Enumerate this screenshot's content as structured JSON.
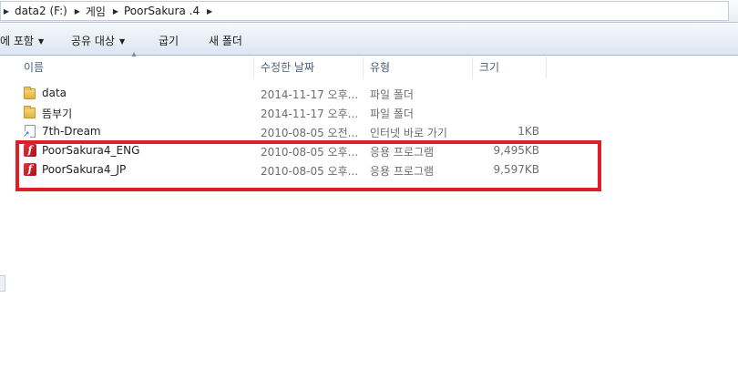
{
  "address_bar": {
    "crumbs": [
      "data2 (F:)",
      "게임",
      "PoorSakura .4"
    ]
  },
  "command_bar": {
    "include_label": "에 포함",
    "share_label": "공유 대상",
    "burn_label": "굽기",
    "new_folder_label": "새 폴더"
  },
  "columns": {
    "name": "이름",
    "date_modified": "수정한 날짜",
    "type": "유형",
    "size": "크기"
  },
  "files": [
    {
      "icon": "folder-icon",
      "name": "data",
      "date": "2014-11-17 오후...",
      "type": "파일 폴더",
      "size": ""
    },
    {
      "icon": "folder-icon",
      "name": "뜸부기",
      "date": "2014-11-17 오후...",
      "type": "파일 폴더",
      "size": ""
    },
    {
      "icon": "internet-shortcut-icon",
      "name": "7th-Dream",
      "date": "2010-08-05 오전...",
      "type": "인터넷 바로 가기",
      "size": "1KB"
    },
    {
      "icon": "flash-app-icon",
      "name": "PoorSakura4_ENG",
      "date": "2010-08-05 오후...",
      "type": "응용 프로그램",
      "size": "9,495KB"
    },
    {
      "icon": "flash-app-icon",
      "name": "PoorSakura4_JP",
      "date": "2010-08-05 오후...",
      "type": "응용 프로그램",
      "size": "9,597KB"
    }
  ],
  "colors": {
    "highlight_box": "#e01e25",
    "toolbar_gradient_top": "#f4f8fc",
    "toolbar_gradient_bottom": "#dce6f1"
  }
}
